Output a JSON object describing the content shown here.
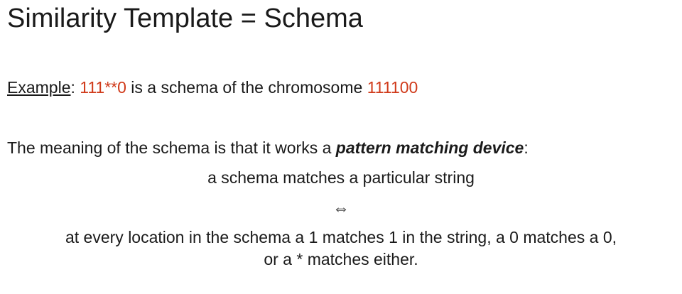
{
  "colors": {
    "accent": "#d03a1a",
    "text": "#1a1a1a",
    "background": "#ffffff"
  },
  "slide": {
    "title": "Similarity Template = Schema",
    "example": {
      "label": "Example",
      "colon": ": ",
      "schema": "111**0",
      "middle": " is a schema of the chromosome ",
      "chromosome": "111100"
    },
    "meaning": {
      "before": "The meaning of the schema is that it works a ",
      "emphasis": "pattern matching device",
      "after": ":"
    },
    "statement": "a schema matches a particular string",
    "iff_symbol": "⇔",
    "rule_line_1": "at every location in the schema a 1 matches 1 in the string, a 0 matches a 0,",
    "rule_line_2": "or a * matches either."
  }
}
